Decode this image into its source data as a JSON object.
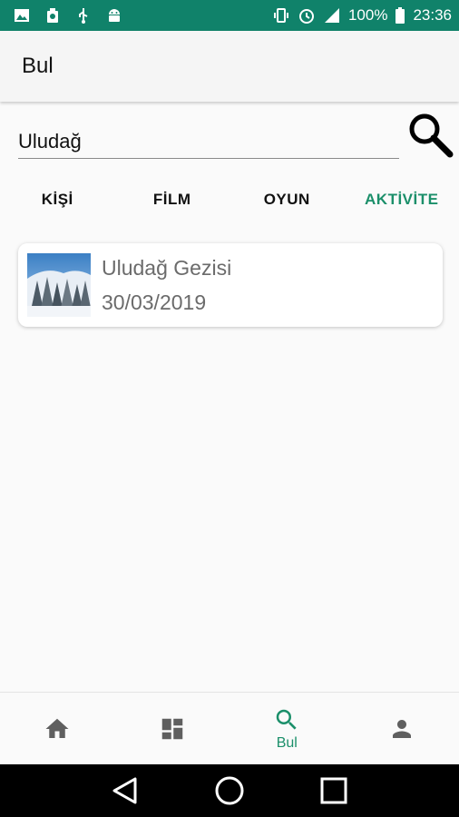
{
  "status_bar": {
    "battery": "100%",
    "time": "23:36",
    "left_icons": [
      "image-icon",
      "clean-icon",
      "usb-icon",
      "android-icon"
    ],
    "right_icons": [
      "vibrate-icon",
      "alarm-icon",
      "signal-icon",
      "battery-icon"
    ]
  },
  "app_bar": {
    "title": "Bul"
  },
  "search": {
    "value": "Uludağ"
  },
  "tabs": [
    {
      "label": "KİŞİ",
      "active": false
    },
    {
      "label": "FİLM",
      "active": false
    },
    {
      "label": "OYUN",
      "active": false
    },
    {
      "label": "AKTİVİTE",
      "active": true
    }
  ],
  "results": [
    {
      "title": "Uludağ Gezisi",
      "date": "30/03/2019",
      "thumbnail": "snowy-forest-image"
    }
  ],
  "bottom_nav": [
    {
      "icon": "home-icon",
      "label": ""
    },
    {
      "icon": "dashboard-icon",
      "label": ""
    },
    {
      "icon": "search-icon",
      "label": "Bul",
      "active": true
    },
    {
      "icon": "person-icon",
      "label": ""
    }
  ],
  "colors": {
    "status_bar": "#10826a",
    "accent": "#1b8f6a",
    "nav_icon": "#5f5f5f"
  }
}
